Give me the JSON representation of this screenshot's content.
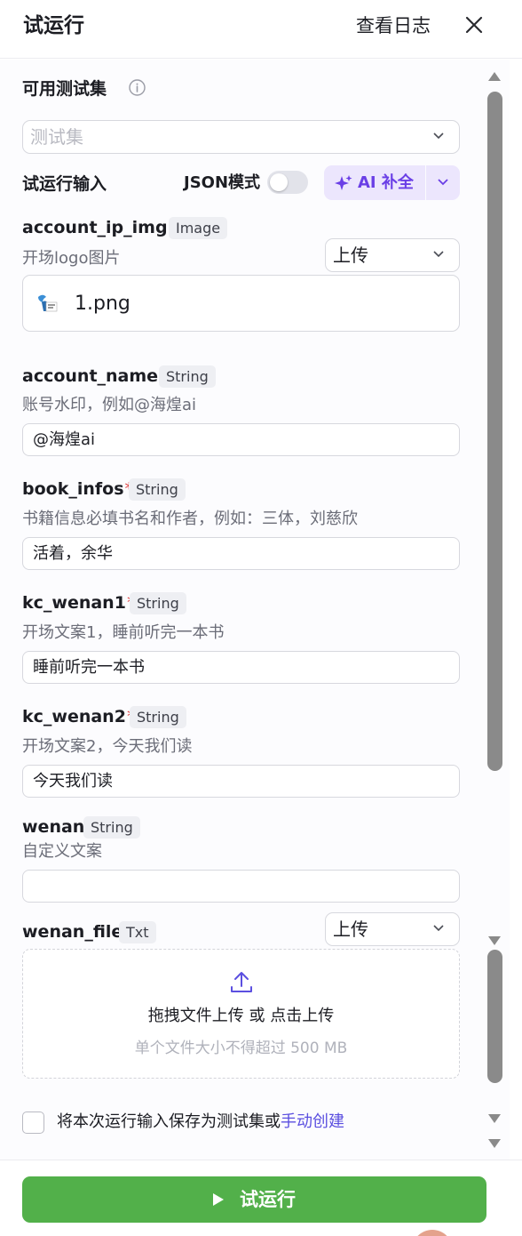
{
  "header": {
    "title": "试运行",
    "log_label": "查看日志"
  },
  "test_set": {
    "label": "可用测试集",
    "placeholder": "测试集"
  },
  "run_input": {
    "label": "试运行输入",
    "json_mode_label": "JSON模式",
    "json_mode_on": false,
    "ai_label": "AI 补全"
  },
  "fields": [
    {
      "name": "account_ip_img",
      "required": true,
      "type": "Image",
      "desc": "开场logo图片",
      "mode": "上传",
      "file_name": "1.png"
    },
    {
      "name": "account_name",
      "required": true,
      "type": "String",
      "desc": "账号水印，例如@海煌ai",
      "value": "@海煌ai"
    },
    {
      "name": "book_infos",
      "required": true,
      "type": "String",
      "desc": "书籍信息必填书名和作者，例如：三体，刘慈欣",
      "value": "活着，余华"
    },
    {
      "name": "kc_wenan1",
      "required": true,
      "type": "String",
      "desc": "开场文案1，睡前听完一本书",
      "value": "睡前听完一本书"
    },
    {
      "name": "kc_wenan2",
      "required": true,
      "type": "String",
      "desc": "开场文案2，今天我们读",
      "value": "今天我们读"
    },
    {
      "name": "wenan",
      "required": false,
      "type": "String",
      "desc": "自定义文案",
      "value": ""
    },
    {
      "name": "wenan_file",
      "required": false,
      "type": "Txt",
      "mode": "上传"
    }
  ],
  "upload": {
    "main": "拖拽文件上传 或 点击上传",
    "sub": "单个文件大小不得超过 500 MB"
  },
  "save": {
    "text": "将本次运行输入保存为测试集或",
    "link": "手动创建"
  },
  "run_button": "试运行",
  "colors": {
    "accent": "#52b04a",
    "ai": "#6a3fe6",
    "link": "#5b4fe0",
    "required": "#e03b3b"
  }
}
